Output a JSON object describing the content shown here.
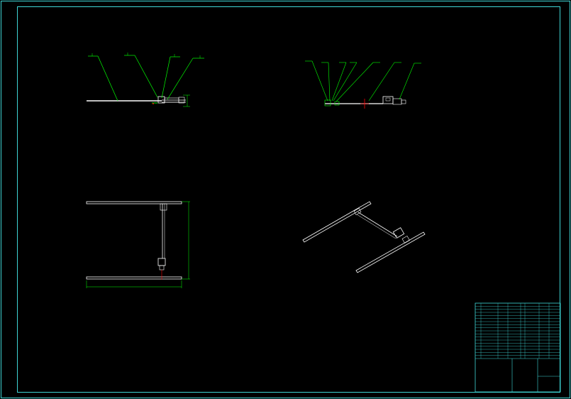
{
  "drawing": {
    "colors": {
      "background": "#000000",
      "border": "#3fd6d6",
      "part_lines": "#ffffff",
      "leader_lines": "#00ff00",
      "dimension_lines": "#00ff00",
      "accent_red": "#ff0000",
      "titleblock_lines": "#3fd6d6",
      "titleblock_text": "#00ff66"
    },
    "views": {
      "front_view": {
        "name": "front-view"
      },
      "side_view": {
        "name": "side-view"
      },
      "top_view": {
        "name": "top-view"
      },
      "iso_view": {
        "name": "isometric-view"
      }
    },
    "technical_notes": {
      "title": "",
      "lines": []
    },
    "title_block": {
      "rows": 18
    }
  }
}
